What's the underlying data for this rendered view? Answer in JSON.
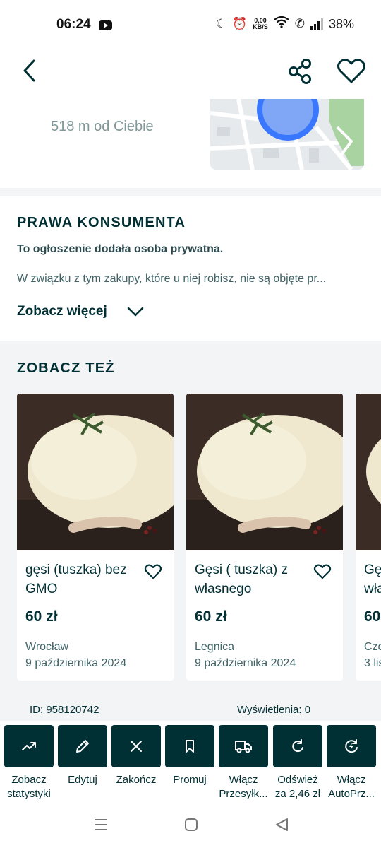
{
  "status_bar": {
    "time": "06:24",
    "net_speed_value": "0,00",
    "net_speed_unit": "KB/S",
    "battery": "38%"
  },
  "nav": {
    "icons": [
      "back-arrow-icon",
      "share-icon",
      "heart-icon"
    ]
  },
  "location": {
    "distance": "518 m od Ciebie"
  },
  "consumer_rights": {
    "title": "PRAWA KONSUMENTA",
    "bold_text": "To ogłoszenie dodała osoba prywatna.",
    "text": "W związku z tym zakupy, które u niej robisz, nie są objęte pr...",
    "see_more": "Zobacz więcej"
  },
  "see_also": {
    "title": "ZOBACZ TEŻ",
    "cards": [
      {
        "title": "gęsi (tuszka) bez GMO",
        "price": "60 zł",
        "city": "Wrocław",
        "date": "9 października 2024"
      },
      {
        "title": "Gęsi ( tuszka) z własnego",
        "price": "60 zł",
        "city": "Legnica",
        "date": "9 października 2024"
      },
      {
        "title": "Gę wła",
        "price": "60",
        "city": "Cze",
        "date": "3 lis"
      }
    ]
  },
  "meta": {
    "id": "ID: 958120742",
    "views": "Wyświetlenia: 0"
  },
  "actions": [
    {
      "label1": "Zobacz",
      "label2": "statystyki",
      "icon": "trending-up-icon"
    },
    {
      "label1": "Edytuj",
      "label2": "",
      "icon": "pencil-icon"
    },
    {
      "label1": "Zakończ",
      "label2": "",
      "icon": "close-icon"
    },
    {
      "label1": "Promuj",
      "label2": "",
      "icon": "bookmark-icon"
    },
    {
      "label1": "Włącz",
      "label2": "Przesyłk...",
      "icon": "delivery-truck-icon"
    },
    {
      "label1": "Odśwież",
      "label2": "za 2,46 zł",
      "icon": "refresh-icon"
    },
    {
      "label1": "Włącz",
      "label2": "AutoPrz...",
      "icon": "auto-refresh-icon"
    }
  ],
  "colors": {
    "brand_dark": "#002f34",
    "muted_text": "#7f9799",
    "background_band": "#f2f4f5",
    "map_pin": "#3a77ff"
  }
}
